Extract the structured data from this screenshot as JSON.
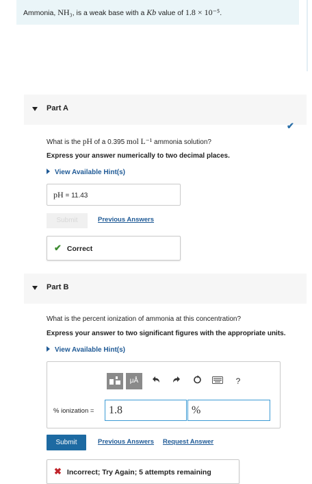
{
  "intro": {
    "text_before": "Ammonia, ",
    "formula": "NH₃",
    "text_middle": ", is a weak base with a ",
    "kb_symbol": "Kb",
    "text_value_pre": " value of ",
    "kb_value": "1.8 × 10⁻⁵",
    "text_end": "."
  },
  "part_a": {
    "title": "Part A",
    "question_pre": "What is the ",
    "question_ph": "pH",
    "question_mid": " of a 0.395 ",
    "question_unit": "mol L⁻¹",
    "question_post": " ammonia solution?",
    "instruction": "Express your answer numerically to two decimal places.",
    "hint_label": "View Available Hint(s)",
    "answer_label": "pH",
    "answer_eq": " = ",
    "answer_value": "11.43",
    "submit_label": "Submit",
    "previous_answers": "Previous Answers",
    "feedback": "Correct",
    "status": "correct"
  },
  "part_b": {
    "title": "Part B",
    "question": "What is the percent ionization of ammonia at this concentration?",
    "instruction": "Express your answer to two significant figures with the appropriate units.",
    "hint_label": "View Available Hint(s)",
    "toolbar": {
      "templates_icon": "templates-icon",
      "units_label": "μÅ",
      "undo_icon": "undo-icon",
      "redo_icon": "redo-icon",
      "reset_icon": "reset-icon",
      "keyboard_icon": "keyboard-icon",
      "help_label": "?"
    },
    "field_label": "% ionization =",
    "value": "1.8",
    "units": "%",
    "submit_label": "Submit",
    "previous_answers": "Previous Answers",
    "request_answer": "Request Answer",
    "feedback": "Incorrect; Try Again; 5 attempts remaining"
  },
  "colors": {
    "accent": "#1d6aa2",
    "correct": "#3b8a2e",
    "incorrect": "#c0242b",
    "intro_bg": "#eaf5f8"
  }
}
